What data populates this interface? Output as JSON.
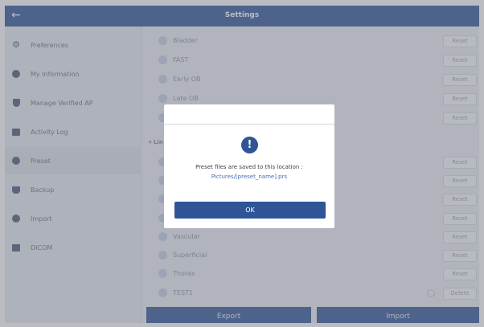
{
  "header": {
    "title": "Settings"
  },
  "sidebar": {
    "items": [
      {
        "label": "Preferences",
        "icon": "gear-icon"
      },
      {
        "label": "My Information",
        "icon": "user-icon"
      },
      {
        "label": "Manage Verified AP",
        "icon": "shield-icon"
      },
      {
        "label": "Activity Log",
        "icon": "log-icon"
      },
      {
        "label": "Preset",
        "icon": "preset-icon"
      },
      {
        "label": "Backup",
        "icon": "backup-icon"
      },
      {
        "label": "Import",
        "icon": "import-icon"
      },
      {
        "label": "DICOM",
        "icon": "dicom-icon"
      }
    ],
    "active_index": 4
  },
  "presets": {
    "top_rows": [
      {
        "label": "Bladder",
        "button": "Reset"
      },
      {
        "label": "FAST",
        "button": "Reset"
      },
      {
        "label": "Early OB",
        "button": "Reset"
      },
      {
        "label": "Late OB",
        "button": "Reset"
      },
      {
        "label": "",
        "button": "Reset"
      }
    ],
    "section_label": "Lin",
    "linear_rows": [
      {
        "label": "",
        "button": "Reset"
      },
      {
        "label": "",
        "button": "Reset"
      },
      {
        "label": "",
        "button": "Reset"
      },
      {
        "label": "",
        "button": "Reset"
      },
      {
        "label": "Vascular",
        "button": "Reset"
      },
      {
        "label": "Superficial",
        "button": "Reset"
      },
      {
        "label": "Thorax",
        "button": "Reset"
      },
      {
        "label": "TEST1",
        "button": "Delete"
      }
    ]
  },
  "footer": {
    "export_label": "Export",
    "import_label": "Import"
  },
  "dialog": {
    "icon": "!",
    "message": "Preset files are saved to this location :",
    "path": "Pictures/[preset_name].prs",
    "ok_label": "OK"
  },
  "colors": {
    "primary": "#2f5597",
    "link": "#4a6fb5",
    "background": "#eef0f4"
  }
}
